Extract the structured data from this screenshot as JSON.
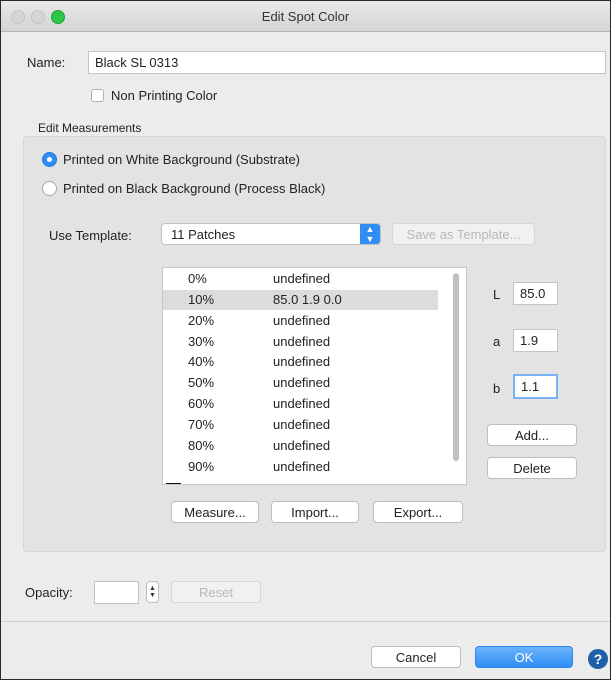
{
  "window": {
    "title": "Edit Spot Color"
  },
  "name": {
    "label": "Name:",
    "value": "Black SL 0313"
  },
  "non_printing": {
    "label": "Non Printing Color",
    "checked": false
  },
  "measurements": {
    "heading": "Edit Measurements",
    "radio_white": {
      "label": "Printed on White Background (Substrate)",
      "selected": true
    },
    "radio_black": {
      "label": "Printed on Black Background (Process Black)",
      "selected": false
    },
    "template_label": "Use Template:",
    "template_value": "11 Patches",
    "save_template": "Save as Template...",
    "patches": [
      {
        "pct": "0%",
        "value": "undefined"
      },
      {
        "pct": "10%",
        "value": "85.0 1.9 0.0"
      },
      {
        "pct": "20%",
        "value": "undefined"
      },
      {
        "pct": "30%",
        "value": "undefined"
      },
      {
        "pct": "40%",
        "value": "undefined"
      },
      {
        "pct": "50%",
        "value": "undefined"
      },
      {
        "pct": "60%",
        "value": "undefined"
      },
      {
        "pct": "70%",
        "value": "undefined"
      },
      {
        "pct": "80%",
        "value": "undefined"
      },
      {
        "pct": "90%",
        "value": "undefined"
      }
    ],
    "selected_index": 1,
    "lab": {
      "l_label": "L",
      "l_value": "85.0",
      "a_label": "a",
      "a_value": "1.9",
      "b_label": "b",
      "b_value": "1.1"
    },
    "add": "Add...",
    "delete": "Delete",
    "measure": "Measure...",
    "import": "Import...",
    "export": "Export..."
  },
  "opacity": {
    "label": "Opacity:",
    "value": "",
    "reset": "Reset"
  },
  "footer": {
    "cancel": "Cancel",
    "ok": "OK",
    "help": "?"
  },
  "colors": {
    "accent": "#2f8df4",
    "help": "#1f5fa8"
  }
}
